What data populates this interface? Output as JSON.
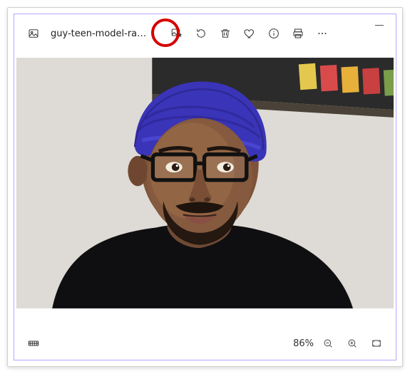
{
  "header": {
    "file_title": "guy-teen-model-rando…"
  },
  "toolbar": {
    "app_icon": "photos-app-icon",
    "edit": "edit-image-icon",
    "rotate": "rotate-icon",
    "delete": "delete-icon",
    "favorite": "heart-icon",
    "info": "info-icon",
    "print": "print-icon",
    "more": "more-icon",
    "minimize": "minimize-icon"
  },
  "footer": {
    "filmstrip": "filmstrip-icon",
    "zoom_label": "86%",
    "zoom_out": "zoom-out-icon",
    "zoom_in": "zoom-in-icon",
    "fit": "fit-to-window-icon"
  },
  "annotation": {
    "highlighted_button": "edit-image-icon"
  }
}
